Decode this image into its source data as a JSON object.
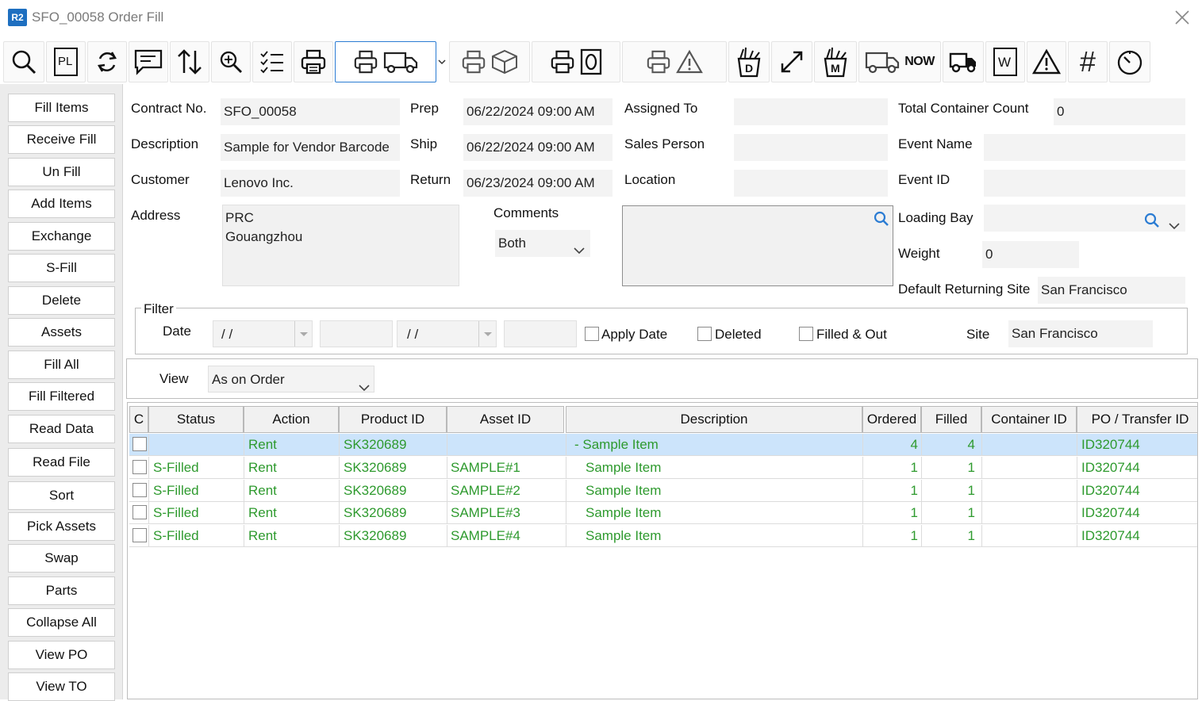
{
  "window": {
    "badge": "R2",
    "title": "SFO_00058 Order Fill"
  },
  "toolbar": {
    "now_label": "NOW",
    "pl_label": "PL",
    "d_label": "D",
    "m_label": "M",
    "w_label": "W",
    "hash_label": "#"
  },
  "sidebar": {
    "buttons": [
      "Fill Items",
      "Receive Fill",
      "Un Fill",
      "Add Items",
      "Exchange",
      "S-Fill",
      "Delete",
      "Assets",
      "Fill  All",
      "Fill Filtered",
      "Read Data",
      "Read File",
      "Sort",
      "Pick Assets",
      "Swap",
      "Parts",
      "Collapse All",
      "View PO",
      "View TO"
    ]
  },
  "form": {
    "contract_label": "Contract No.",
    "contract": "SFO_00058",
    "description_label": "Description",
    "description": "Sample for Vendor Barcode",
    "customer_label": "Customer",
    "customer": "Lenovo Inc.",
    "address_label": "Address",
    "address_line1": "PRC",
    "address_line2": "Gouangzhou",
    "prep_label": "Prep",
    "prep": "06/22/2024 09:00 AM",
    "ship_label": "Ship",
    "ship": "06/22/2024 09:00 AM",
    "return_label": "Return",
    "return": "06/23/2024 09:00 AM",
    "comments_label": "Comments",
    "comments_select": "Both",
    "assigned_label": "Assigned To",
    "assigned": "",
    "salesperson_label": "Sales Person",
    "salesperson": "",
    "location_label": "Location",
    "location": "",
    "total_container_label": "Total Container Count",
    "total_container": "0",
    "event_name_label": "Event Name",
    "event_name": "",
    "event_id_label": "Event ID",
    "event_id": "",
    "loading_bay_label": "Loading Bay",
    "loading_bay": "",
    "weight_label": "Weight",
    "weight": "0",
    "default_site_label": "Default Returning Site",
    "default_site": "San Francisco"
  },
  "filter": {
    "title": "Filter",
    "date_label": "Date",
    "date_from": "/ /",
    "time_from": "",
    "date_to": "/ /",
    "time_to": "",
    "apply_date_label": "Apply Date",
    "deleted_label": "Deleted",
    "filled_out_label": "Filled & Out",
    "site_label": "Site",
    "site": "San Francisco"
  },
  "view": {
    "label": "View",
    "selected": "As on Order"
  },
  "grid": {
    "columns": [
      "C",
      "Status",
      "Action",
      "Product ID",
      "Asset ID",
      "Description",
      "Ordered",
      "Filled",
      "Container ID",
      "PO / Transfer ID"
    ],
    "rows": [
      {
        "status": "",
        "action": "Rent",
        "product_id": "SK320689",
        "asset_id": "",
        "description": "- Sample Item",
        "ordered": "4",
        "filled": "4",
        "container_id": "",
        "po": "ID320744"
      },
      {
        "status": "S-Filled",
        "action": "Rent",
        "product_id": "SK320689",
        "asset_id": "SAMPLE#1",
        "description": "Sample Item",
        "ordered": "1",
        "filled": "1",
        "container_id": "",
        "po": "ID320744"
      },
      {
        "status": "S-Filled",
        "action": "Rent",
        "product_id": "SK320689",
        "asset_id": "SAMPLE#2",
        "description": "Sample Item",
        "ordered": "1",
        "filled": "1",
        "container_id": "",
        "po": "ID320744"
      },
      {
        "status": "S-Filled",
        "action": "Rent",
        "product_id": "SK320689",
        "asset_id": "SAMPLE#3",
        "description": "Sample Item",
        "ordered": "1",
        "filled": "1",
        "container_id": "",
        "po": "ID320744"
      },
      {
        "status": "S-Filled",
        "action": "Rent",
        "product_id": "SK320689",
        "asset_id": "SAMPLE#4",
        "description": "Sample Item",
        "ordered": "1",
        "filled": "1",
        "container_id": "",
        "po": "ID320744"
      }
    ]
  },
  "colors": {
    "accent": "#2b7cd3",
    "row_text": "#2e9a2e",
    "row_highlight": "#cce4fb"
  }
}
